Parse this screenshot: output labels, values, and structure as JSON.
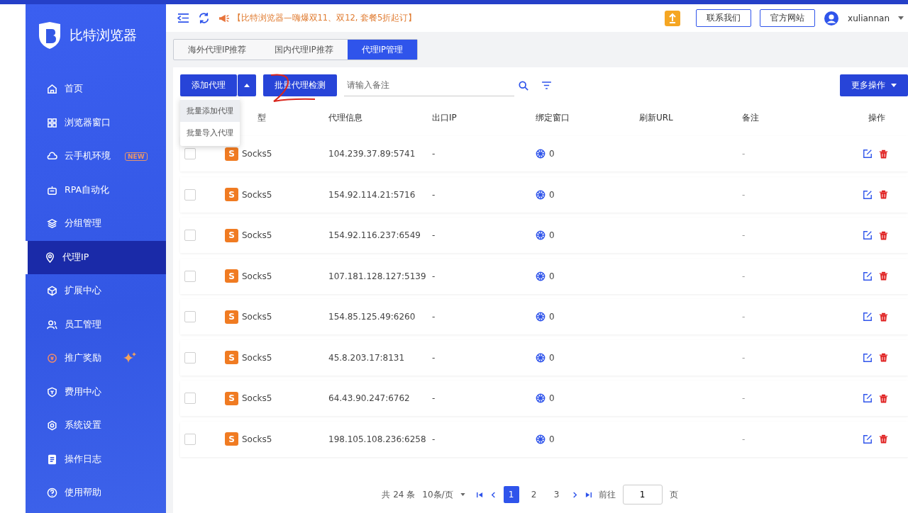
{
  "sidebar": {
    "brand": "比特浏览器",
    "items": [
      {
        "label": "首页",
        "selected": false
      },
      {
        "label": "浏览器窗口",
        "selected": false
      },
      {
        "label": "云手机环境",
        "selected": false,
        "badge": "NEW"
      },
      {
        "label": "RPA自动化",
        "selected": false
      },
      {
        "label": "分组管理",
        "selected": false
      },
      {
        "label": "代理IP",
        "selected": true
      },
      {
        "label": "扩展中心",
        "selected": false
      },
      {
        "label": "员工管理",
        "selected": false
      },
      {
        "label": "推广奖励",
        "selected": false,
        "sparkle": true
      },
      {
        "label": "费用中心",
        "selected": false
      },
      {
        "label": "系统设置",
        "selected": false
      },
      {
        "label": "操作日志",
        "selected": false
      },
      {
        "label": "使用帮助",
        "selected": false
      }
    ]
  },
  "header": {
    "announcement": "【比特浏览器—嗨爆双11、双12, 套餐5折起订】",
    "buttons": [
      "联系我们",
      "官方网站"
    ],
    "username": "xuliannan"
  },
  "tabs": [
    {
      "label": "海外代理IP推荐",
      "selected": false
    },
    {
      "label": "国内代理IP推荐",
      "selected": false
    },
    {
      "label": "代理IP管理",
      "selected": true
    }
  ],
  "toolbar": {
    "add_button": "添加代理",
    "batch_check_button": "批量代理检测",
    "search": {
      "placeholder": "请输入备注"
    },
    "more_button": "更多操作",
    "dropdown": [
      "批量添加代理",
      "批量导入代理"
    ]
  },
  "table": {
    "columns": [
      "型",
      "代理信息",
      "出口IP",
      "绑定窗口",
      "刷新URL",
      "备注",
      "操作"
    ],
    "rows": [
      {
        "checked": false,
        "type_badge": "S",
        "type": "Socks5",
        "proxy": "104.239.37.89:5741",
        "exit_ip": "-",
        "windows": "0",
        "note": "-"
      },
      {
        "checked": false,
        "type_badge": "S",
        "type": "Socks5",
        "proxy": "154.92.114.21:5716",
        "exit_ip": "-",
        "windows": "0",
        "note": "-"
      },
      {
        "checked": false,
        "type_badge": "S",
        "type": "Socks5",
        "proxy": "154.92.116.237:6549",
        "exit_ip": "-",
        "windows": "0",
        "note": "-"
      },
      {
        "checked": false,
        "type_badge": "S",
        "type": "Socks5",
        "proxy": "107.181.128.127:5139",
        "exit_ip": "-",
        "windows": "0",
        "note": "-"
      },
      {
        "checked": false,
        "type_badge": "S",
        "type": "Socks5",
        "proxy": "154.85.125.49:6260",
        "exit_ip": "-",
        "windows": "0",
        "note": "-"
      },
      {
        "checked": false,
        "type_badge": "S",
        "type": "Socks5",
        "proxy": "45.8.203.17:8131",
        "exit_ip": "-",
        "windows": "0",
        "note": "-"
      },
      {
        "checked": false,
        "type_badge": "S",
        "type": "Socks5",
        "proxy": "64.43.90.247:6762",
        "exit_ip": "-",
        "windows": "0",
        "note": "-"
      },
      {
        "checked": false,
        "type_badge": "S",
        "type": "Socks5",
        "proxy": "198.105.108.236:6258",
        "exit_ip": "-",
        "windows": "0",
        "note": "-"
      }
    ]
  },
  "pagination": {
    "total": "共 24 条",
    "page_size": "10条/页",
    "pages": [
      {
        "label": "1",
        "selected": true
      },
      {
        "label": "2",
        "selected": false
      },
      {
        "label": "3",
        "selected": false
      }
    ],
    "goto_label": "前往",
    "goto_value": "1",
    "page_unit": "页"
  }
}
